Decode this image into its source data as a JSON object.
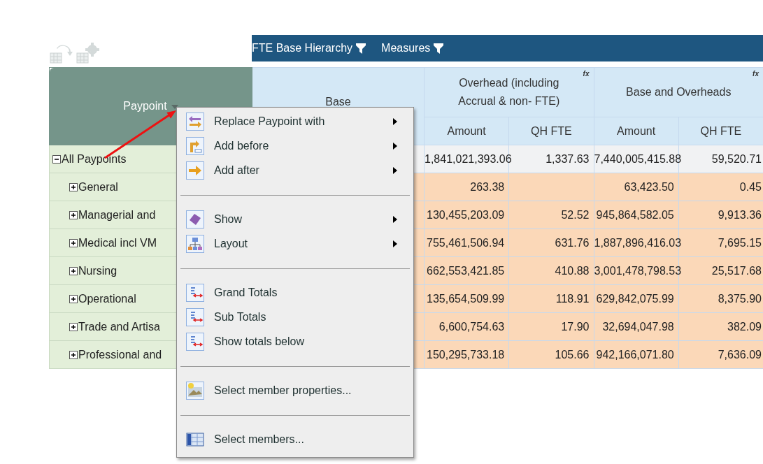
{
  "toolbar": [
    {
      "disabled": true
    },
    {
      "disabled": true
    }
  ],
  "axis_bar": {
    "items": [
      {
        "label": "FTE Base Hierarchy"
      },
      {
        "label": "Measures"
      }
    ]
  },
  "row_header": {
    "label": "Paypoint"
  },
  "column_groups": [
    {
      "label": "Base"
    },
    {
      "label": "Overhead  (including Accrual  & non- FTE)",
      "formula_mark": "fx",
      "columns": [
        "Amount",
        "QH FTE"
      ]
    },
    {
      "label": "Base and Overheads",
      "formula_mark": "fx",
      "columns": [
        "Amount",
        "QH FTE"
      ]
    }
  ],
  "rows": [
    {
      "label": "All Paypoints",
      "expanded": true,
      "cells": [
        "1,841,021,393.06",
        "1,337.63",
        "7,440,005,415.88",
        "59,520.71"
      ],
      "children": [
        {
          "label": "General",
          "expanded": false,
          "cells": [
            "263.38",
            null,
            "63,423.50",
            "0.45"
          ]
        },
        {
          "label": "Managerial and",
          "expanded": false,
          "cells": [
            "130,455,203.09",
            "52.52",
            "945,864,582.05",
            "9,913.36"
          ]
        },
        {
          "label": "Medical incl VM",
          "expanded": false,
          "cells": [
            "755,461,506.94",
            "631.76",
            "1,887,896,416.03",
            "7,695.15"
          ]
        },
        {
          "label": "Nursing",
          "expanded": false,
          "cells": [
            "662,553,421.85",
            "410.88",
            "3,001,478,798.53",
            "25,517.68"
          ]
        },
        {
          "label": "Operational",
          "expanded": false,
          "cells": [
            "135,654,509.99",
            "118.91",
            "629,842,075.99",
            "8,375.90"
          ]
        },
        {
          "label": "Trade and Artisa",
          "expanded": false,
          "cells": [
            "6,600,754.63",
            "17.90",
            "32,694,047.98",
            "382.09"
          ]
        },
        {
          "label": "Professional and",
          "expanded": false,
          "cells": [
            "150,295,733.18",
            "105.66",
            "942,166,071.80",
            "7,636.09"
          ]
        }
      ]
    }
  ],
  "context_menu": {
    "sections": [
      [
        {
          "label": "Replace Paypoint with",
          "submenu": true
        },
        {
          "label": "Add before",
          "submenu": true
        },
        {
          "label": "Add after",
          "submenu": true
        }
      ],
      [
        {
          "label": "Show",
          "submenu": true
        },
        {
          "label": "Layout",
          "submenu": true
        }
      ],
      [
        {
          "label": "Grand Totals",
          "submenu": false
        },
        {
          "label": "Sub Totals",
          "submenu": false
        },
        {
          "label": "Show totals below",
          "submenu": false
        }
      ],
      [
        {
          "label": "Select member properties...",
          "submenu": false
        }
      ],
      [
        {
          "label": "Select members...",
          "submenu": false
        }
      ]
    ]
  }
}
